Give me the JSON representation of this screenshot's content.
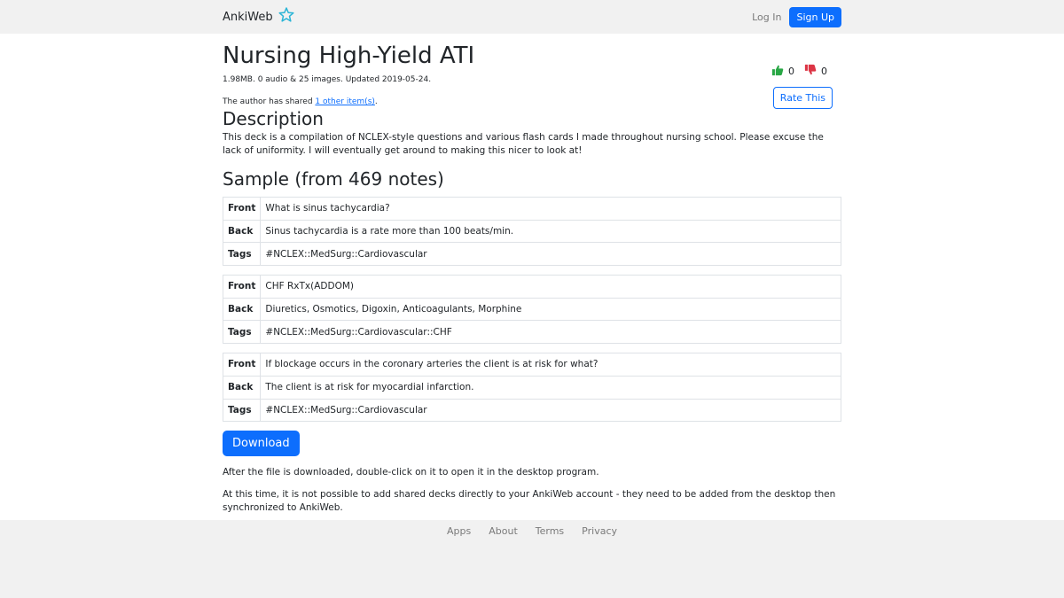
{
  "nav": {
    "brand": "AnkiWeb",
    "login": "Log In",
    "signup": "Sign Up"
  },
  "deck": {
    "title": "Nursing High-Yield ATI",
    "meta": "1.98MB. 0 audio & 25 images. Updated 2019-05-24.",
    "shared_prefix": "The author has shared ",
    "shared_link": "1 other item(s)",
    "shared_suffix": ".",
    "upvotes": "0",
    "downvotes": "0",
    "rate_label": "Rate This"
  },
  "description": {
    "heading": "Description",
    "text": "This deck is a compilation of NCLEX-style questions and various flash cards I made throughout nursing school. Please excuse the lack of uniformity. I will eventually get around to making this nicer to look at!"
  },
  "sample": {
    "heading": "Sample (from 469 notes)",
    "labels": {
      "front": "Front",
      "back": "Back",
      "tags": "Tags"
    },
    "cards": [
      {
        "front": "What is sinus tachycardia?",
        "back": "Sinus tachycardia is a rate more than 100 beats/min.",
        "tags": "#NCLEX::MedSurg::Cardiovascular"
      },
      {
        "front": "CHF RxTx(ADDOM)",
        "back": "Diuretics, Osmotics, Digoxin, Anticoagulants, Morphine",
        "tags": "#NCLEX::MedSurg::Cardiovascular::CHF"
      },
      {
        "front": "If blockage occurs in the coronary arteries the client is at risk for what?",
        "back": "The client is at risk for myocardial infarction.",
        "tags": "#NCLEX::MedSurg::Cardiovascular"
      }
    ]
  },
  "download": {
    "button": "Download",
    "after": "After the file is downloaded, double-click on it to open it in the desktop program.",
    "notice": "At this time, it is not possible to add shared decks directly to your AnkiWeb account - they need to be added from the desktop then synchronized to AnkiWeb."
  },
  "footer": {
    "links": [
      "Apps",
      "About",
      "Terms",
      "Privacy"
    ]
  },
  "colors": {
    "accent": "#0d6efd",
    "thumb_up": "#28a745",
    "thumb_down": "#dc3545",
    "star": "#2ab4d6"
  }
}
